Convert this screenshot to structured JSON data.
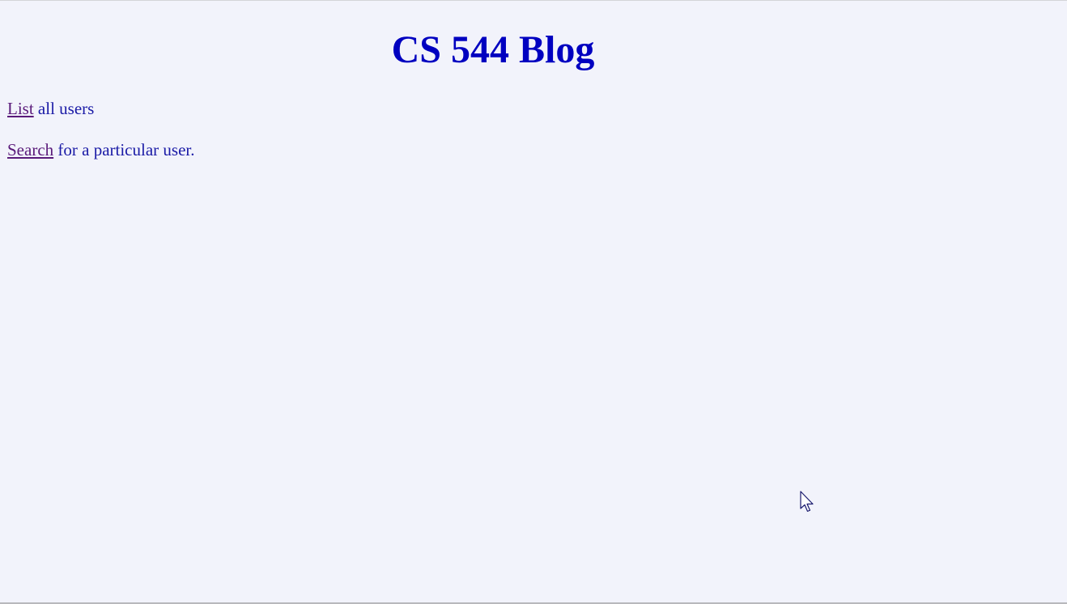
{
  "page": {
    "title": "CS 544 Blog"
  },
  "links": {
    "list": {
      "label": "List",
      "suffix": " all users"
    },
    "search": {
      "label": "Search",
      "suffix": " for a particular user."
    }
  },
  "colors": {
    "background": "#f2f3fb",
    "heading": "#0000c0",
    "text": "#1a1aa6",
    "link": "#5a1a7a"
  },
  "icons": {
    "cursor": "mouse-pointer-icon"
  }
}
